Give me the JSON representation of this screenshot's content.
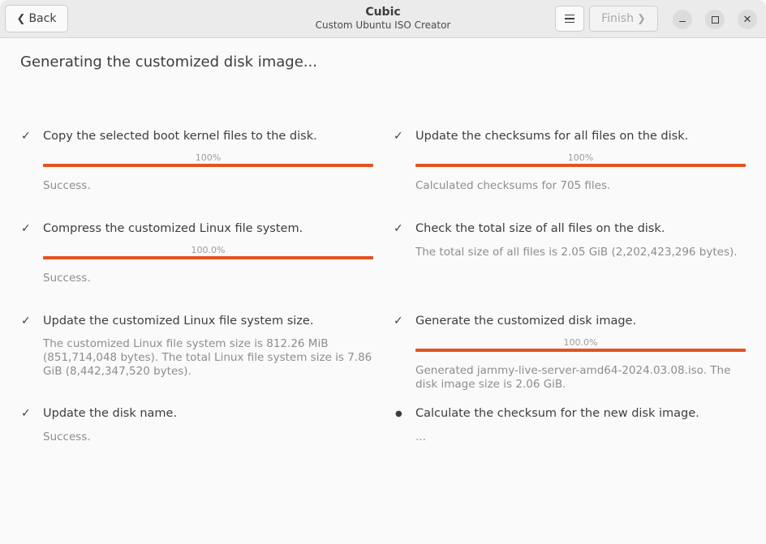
{
  "header": {
    "title": "Cubic",
    "subtitle": "Custom Ubuntu ISO Creator",
    "back_label": "Back",
    "finish_label": "Finish",
    "back_chevron": "❮",
    "finish_chevron": "❯",
    "close_glyph": "✕"
  },
  "heading": "Generating the customized disk image...",
  "colors": {
    "accent": "#e2541f"
  },
  "steps": {
    "copy_kernel": {
      "mark": "✓",
      "label": "Copy the selected boot kernel files to the disk.",
      "progress_text": "100%",
      "progress": 1.0,
      "status": "Success."
    },
    "compress_fs": {
      "mark": "✓",
      "label": "Compress the customized Linux file system.",
      "progress_text": "100.0%",
      "progress": 1.0,
      "status": "Success."
    },
    "update_fs_size": {
      "mark": "✓",
      "label": "Update the customized Linux file system size.",
      "status": "The customized Linux file system size is 812.26 MiB (851,714,048 bytes). The total Linux file system size is 7.86 GiB (8,442,347,520 bytes)."
    },
    "update_disk_name": {
      "mark": "✓",
      "label": "Update the disk name.",
      "status": "Success."
    },
    "update_checksums": {
      "mark": "✓",
      "label": "Update the checksums for all files on the disk.",
      "progress_text": "100%",
      "progress": 1.0,
      "status": "Calculated checksums for 705 files."
    },
    "check_total_size": {
      "mark": "✓",
      "label": "Check the total size of all files on the disk.",
      "status": "The total size of all files is 2.05 GiB (2,202,423,296 bytes)."
    },
    "generate_image": {
      "mark": "✓",
      "label": "Generate the customized disk image.",
      "progress_text": "100.0%",
      "progress": 1.0,
      "status": "Generated jammy-live-server-amd64-2024.03.08.iso. The disk image size is 2.06 GiB."
    },
    "calculate_checksum": {
      "mark": "●",
      "label": "Calculate the checksum for the new disk image.",
      "status": "..."
    }
  }
}
